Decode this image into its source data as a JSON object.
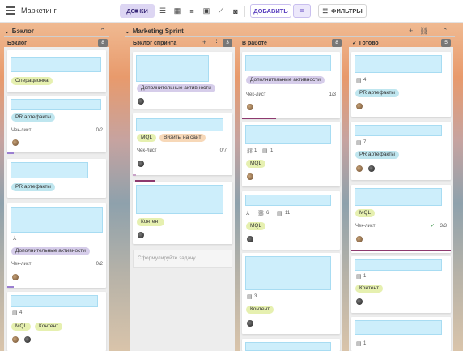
{
  "app": {
    "title": "Маркетинг"
  },
  "toolbar": {
    "boards_label": "ДОСКИ",
    "add_label": "ДОБАВИТЬ",
    "eq_label": "=",
    "filters_label": "ФИЛЬТРЫ"
  },
  "groups": [
    {
      "name": "Бэклог",
      "columns": [
        {
          "name": "Бэклог",
          "count": "8"
        }
      ]
    },
    {
      "name": "Marketing Sprint",
      "columns": [
        {
          "name": "Бэклог спринта",
          "count": "3"
        },
        {
          "name": "В работе",
          "count": "8"
        },
        {
          "name": "Готово",
          "count": "5"
        }
      ]
    }
  ],
  "cards": {
    "c1": {
      "tag1": "Операционка"
    },
    "c2": {
      "tag1": "PR артефакты",
      "check": "Чек-лист",
      "check_val": "0/2"
    },
    "c3": {
      "tag1": "PR артефакты"
    },
    "c4": {
      "tag1": "Дополнительные активности",
      "check": "Чек-лист",
      "check_val": "0/2"
    },
    "c5": {
      "comments": "4",
      "tag1": "MQL",
      "tag2": "Контент"
    },
    "s1": {
      "tag1": "Дополнительные активности"
    },
    "s2": {
      "tag1": "MQL",
      "tag2": "Визиты на сайт",
      "check": "Чек-лист",
      "check_val": "0/7"
    },
    "s3": {
      "tag1": "Контент"
    },
    "s_ph": {
      "placeholder": "Сформулируйте задачу..."
    },
    "w1": {
      "tag1": "Дополнительные активности",
      "check": "Чек-лист",
      "check_val": "1/3"
    },
    "w2": {
      "links": "1",
      "comments": "1",
      "tag1": "MQL"
    },
    "w3": {
      "links": "6",
      "comments": "11",
      "tag1": "MQL"
    },
    "w4": {
      "comments": "3",
      "tag1": "Контент"
    },
    "d1": {
      "comments": "4",
      "tag1": "PR артефакты"
    },
    "d2": {
      "comments": "7",
      "tag1": "PR артефакты"
    },
    "d3": {
      "tag1": "MQL",
      "check": "Чек-лист",
      "check_val": "3/3"
    },
    "d4": {
      "comments": "1",
      "tag1": "Контент"
    },
    "d5": {
      "comments": "1"
    }
  }
}
